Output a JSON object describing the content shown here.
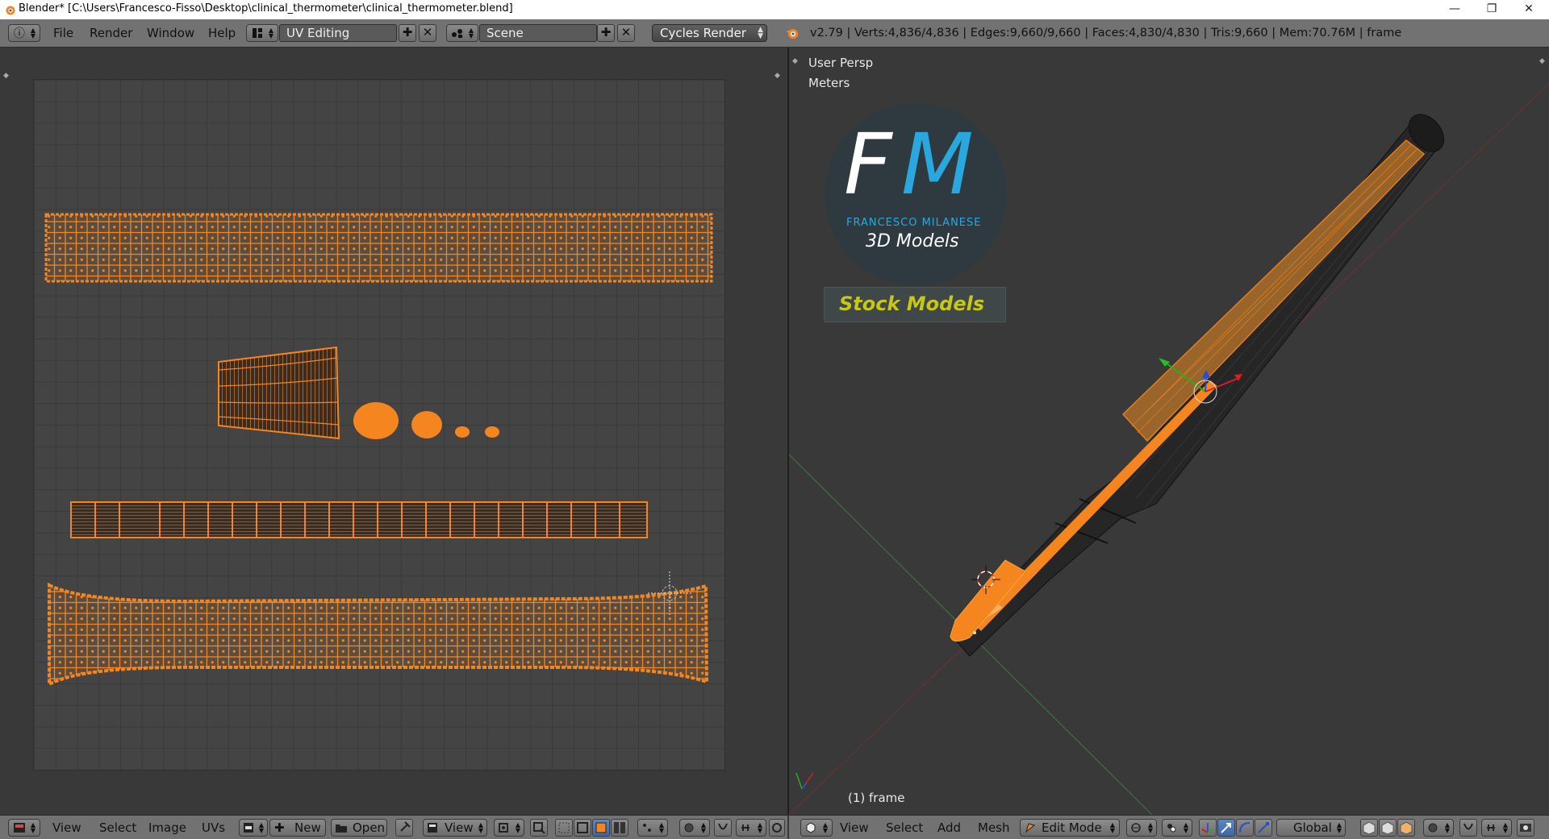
{
  "window": {
    "title": "Blender* [C:\\Users\\Francesco-Fisso\\Desktop\\clinical_thermometer\\clinical_thermometer.blend]",
    "min_glyph": "—",
    "max_glyph": "❐",
    "close_glyph": "✕"
  },
  "topbar": {
    "info_icon": "ⓘ",
    "menus": [
      "File",
      "Render",
      "Window",
      "Help"
    ],
    "screen_layout": "UV Editing",
    "scene": "Scene",
    "render_engine": "Cycles Render",
    "stats": "v2.79 | Verts:4,836/4,836 | Edges:9,660/9,660 | Faces:4,830/4,830 | Tris:9,660 | Mem:70.76M | frame"
  },
  "viewport": {
    "view_label": "User Persp",
    "units_label": "Meters",
    "frame_label": "(1) frame"
  },
  "logo": {
    "monogram_f": "F",
    "monogram_m": "M",
    "name": "FRANCESCO MILANESE",
    "subtitle": "3D Models",
    "stock": "Stock Models"
  },
  "uv_header": {
    "menus": [
      "View",
      "Select",
      "Image",
      "UVs"
    ],
    "new_label": "New",
    "open_label": "Open",
    "view_label": "View"
  },
  "view3d_header": {
    "menus": [
      "View",
      "Select",
      "Add",
      "Mesh"
    ],
    "mode": "Edit Mode",
    "orientation": "Global"
  },
  "colors": {
    "accent_orange": "#f5861f",
    "fm_blue": "#29a8e0",
    "stock_yellow": "#c8c813",
    "header_gray": "#727272"
  }
}
